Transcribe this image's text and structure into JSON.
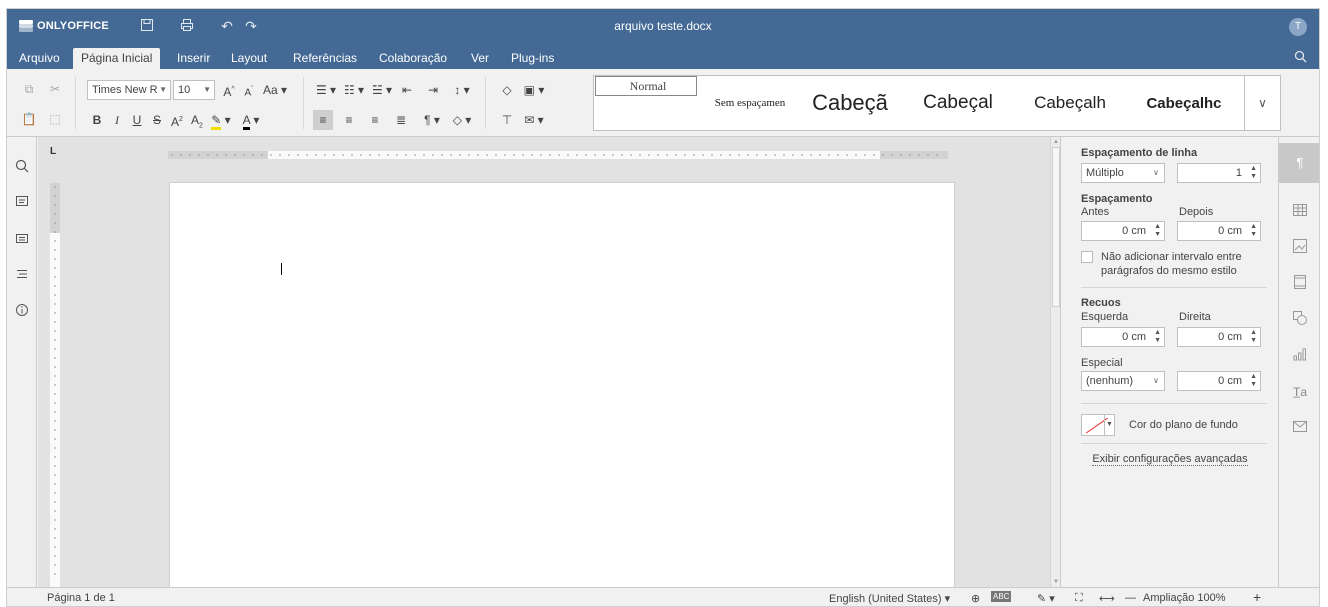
{
  "app": {
    "brand": "ONLYOFFICE",
    "doc_title": "arquivo teste.docx",
    "user_initial": "T"
  },
  "menu": {
    "tabs": [
      "Arquivo",
      "Página Inicial",
      "Inserir",
      "Layout",
      "Referências",
      "Colaboração",
      "Ver",
      "Plug-ins"
    ],
    "active": "Página Inicial"
  },
  "toolbar": {
    "font_name": "Times New R",
    "font_size": "10",
    "styles": [
      "Normal",
      "Sem espaçamen",
      "Cabeçã",
      "Cabeçal",
      "Cabeçalh",
      "Cabeçalhc"
    ]
  },
  "panel": {
    "line_spacing_title": "Espaçamento de linha",
    "line_spacing_type": "Múltiplo",
    "line_spacing_value": "1",
    "spacing_title": "Espaçamento",
    "before_label": "Antes",
    "after_label": "Depois",
    "before_value": "0 cm",
    "after_value": "0 cm",
    "no_interval_line1": "Não adicionar intervalo entre",
    "no_interval_line2": "parágrafos do mesmo estilo",
    "indents_title": "Recuos",
    "left_label": "Esquerda",
    "right_label": "Direita",
    "left_value": "0 cm",
    "right_value": "0 cm",
    "special_label": "Especial",
    "special_type": "(nenhum)",
    "special_value": "0 cm",
    "bg_color_label": "Cor do plano de fundo",
    "advanced_link": "Exibir configurações avançadas"
  },
  "status": {
    "page": "Página 1 de 1",
    "language": "English (United States)",
    "zoom": "Ampliação 100%"
  }
}
